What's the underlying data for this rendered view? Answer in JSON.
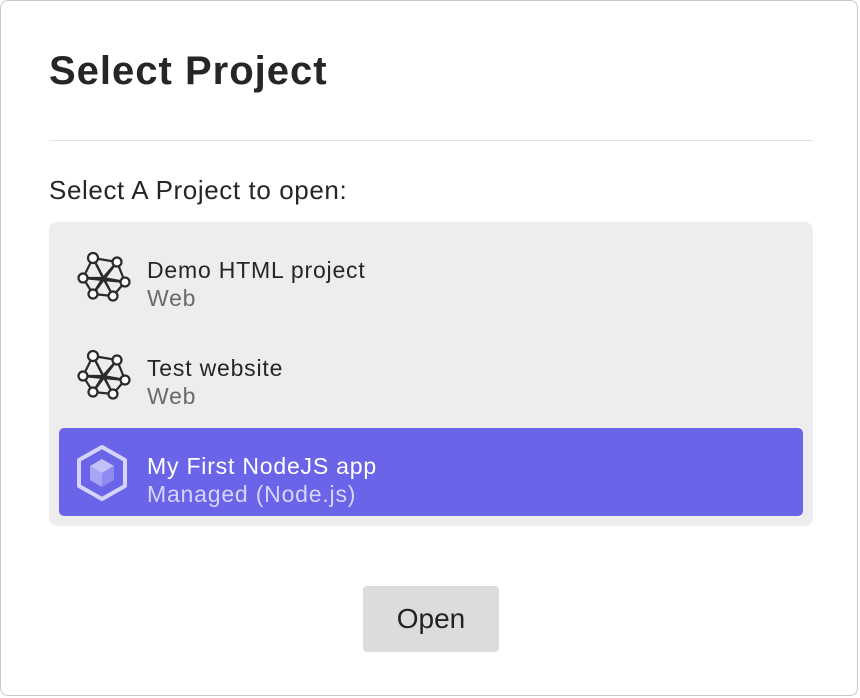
{
  "dialog": {
    "title": "Select Project",
    "prompt": "Select A Project to open:",
    "open_button_label": "Open"
  },
  "projects": [
    {
      "name": "Demo HTML project",
      "type": "Web",
      "icon": "network-mesh-icon",
      "selected": false
    },
    {
      "name": "Test website",
      "type": "Web",
      "icon": "network-mesh-icon",
      "selected": false
    },
    {
      "name": "My First NodeJS app",
      "type": "Managed (Node.js)",
      "icon": "nodejs-hexagon-icon",
      "selected": true
    }
  ],
  "colors": {
    "selection": "#6a65e8",
    "list_background": "#ededed",
    "button_background": "#dcdcdc"
  }
}
